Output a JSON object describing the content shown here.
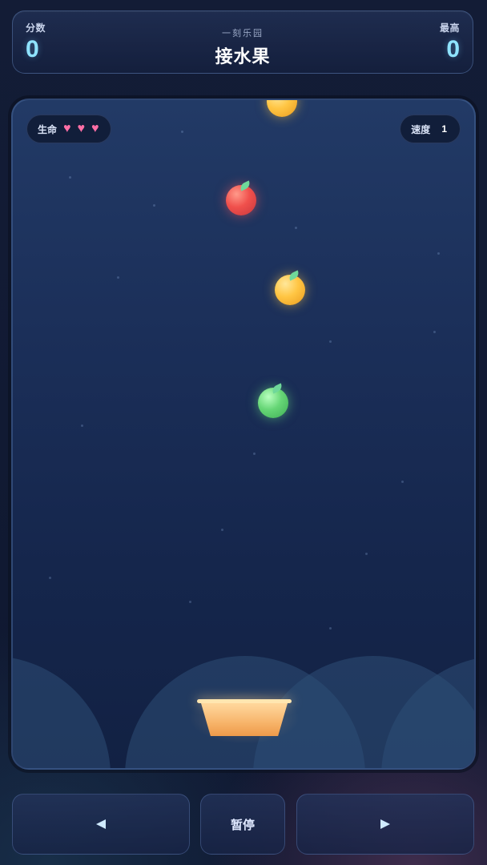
{
  "header": {
    "score_label": "分数",
    "score_value": "0",
    "subtitle": "一刻乐园",
    "title": "接水果",
    "best_label": "最高",
    "best_value": "0"
  },
  "hud": {
    "lives_label": "生命",
    "lives": 3,
    "heart_glyph": "♥",
    "speed_label": "速度",
    "speed_value": "1"
  },
  "fruits": [
    {
      "kind": "orange"
    },
    {
      "kind": "apple"
    },
    {
      "kind": "orange"
    },
    {
      "kind": "lime"
    }
  ],
  "controls": {
    "left_icon": "left-arrow-icon",
    "pause_label": "暂停",
    "right_icon": "right-arrow-icon"
  },
  "colors": {
    "accent": "#8fe3ff",
    "heart": "#ff6fa6",
    "apple": "#f0504c",
    "orange": "#ffc543",
    "lime": "#66d676",
    "basket": "#f7b46a"
  }
}
